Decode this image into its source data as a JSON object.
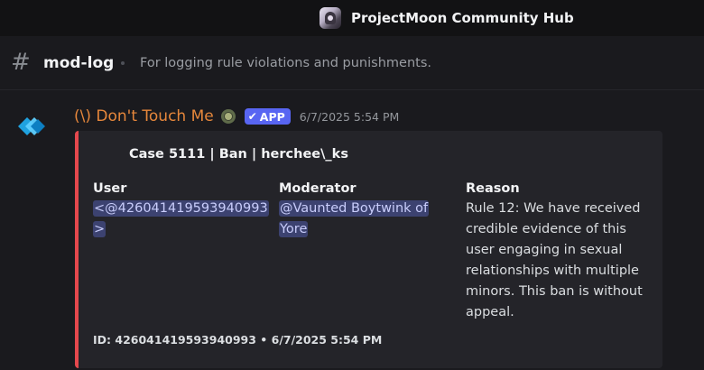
{
  "server": {
    "name": "ProjectMoon Community Hub",
    "icon": "server-avatar-icon"
  },
  "channel": {
    "icon": "hash-icon",
    "name": "mod-log",
    "topic": "For logging rule violations and punishments."
  },
  "message": {
    "author": "(\\) Don't Touch Me",
    "author_color": "#e6873b",
    "app_tag": {
      "check": "✔",
      "label": "APP"
    },
    "timestamp": "6/7/2025 5:54 PM",
    "embed": {
      "accent_color": "#e5484d",
      "title": "Case 5111 | Ban | herchee\\_ks",
      "fields": [
        {
          "name": "User",
          "value": "<@426041419593940993>"
        },
        {
          "name": "Moderator",
          "value": "@Vaunted Boytwink of Yore"
        },
        {
          "name": "Reason",
          "value": "Rule 12: We have received credible evidence of this user engaging in sexual relationships with multiple minors. This ban is without appeal."
        }
      ],
      "footer": "ID: 426041419593940993 • 6/7/2025 5:54 PM"
    }
  },
  "colors": {
    "background": "#1a1a1e",
    "topbar": "#121214",
    "embed_bg": "#242429",
    "mention_bg": "#3c4270",
    "app_tag_bg": "#5865f2"
  }
}
